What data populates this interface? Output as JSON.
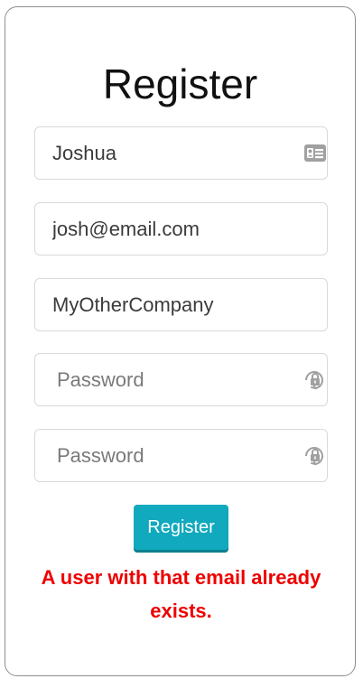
{
  "form": {
    "title": "Register",
    "name": {
      "value": "Joshua",
      "icon": "id-card-icon"
    },
    "email": {
      "value": "josh@email.com"
    },
    "company": {
      "value": "MyOtherCompany"
    },
    "password": {
      "placeholder": "Password",
      "icon": "lock-icon"
    },
    "confirm_password": {
      "placeholder": "Password",
      "icon": "lock-icon"
    },
    "submit_label": "Register",
    "error_message": "A user with that email already exists."
  },
  "colors": {
    "button_bg": "#10a9bd",
    "error_text": "#ee0000",
    "icon_gray": "#999999"
  }
}
